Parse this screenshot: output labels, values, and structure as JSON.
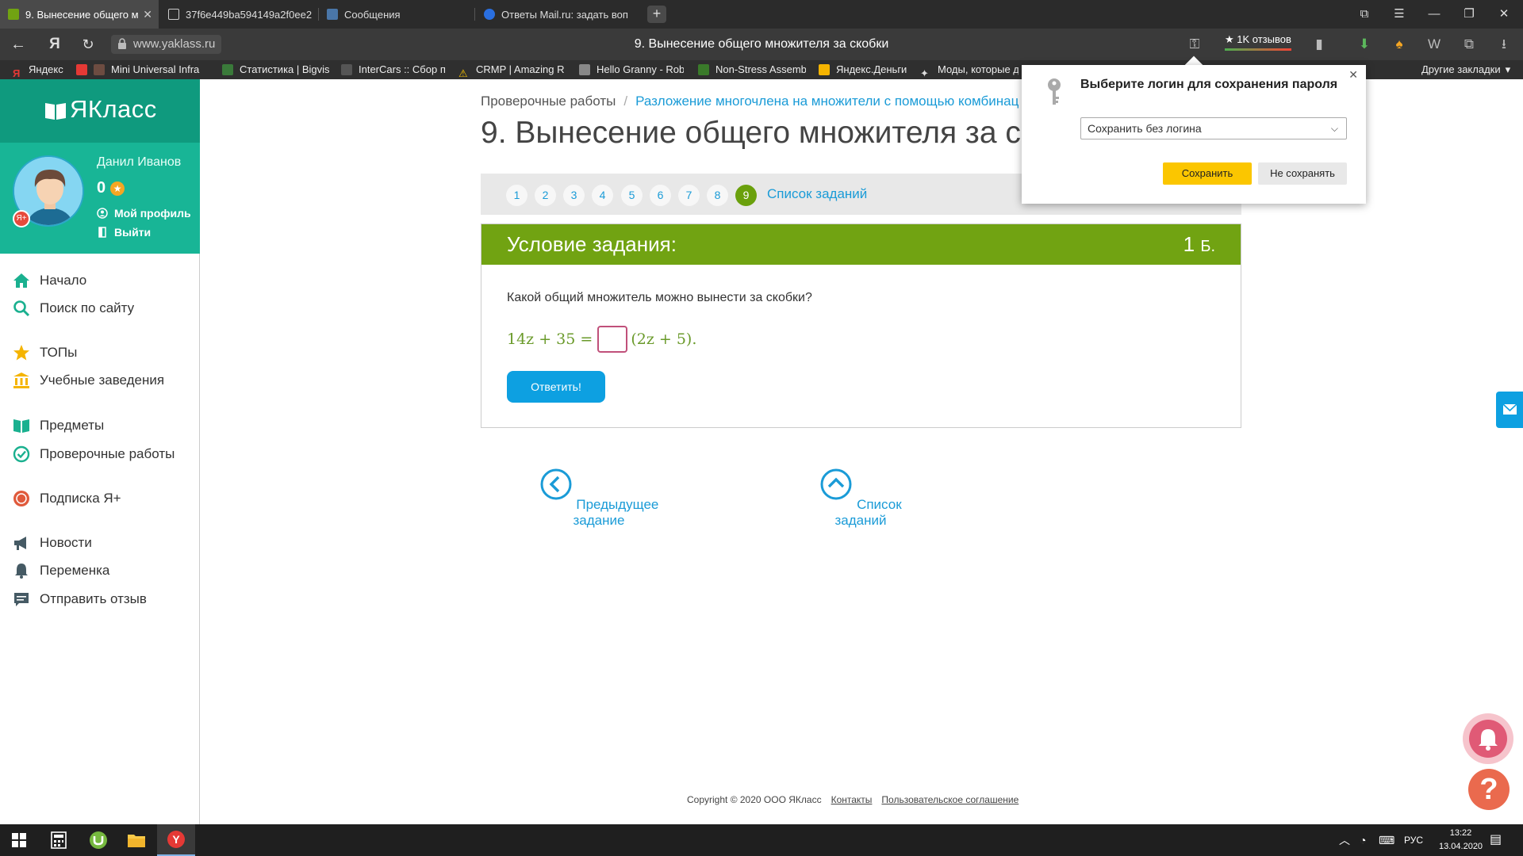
{
  "browser": {
    "tabs": [
      {
        "title": "9. Вынесение общего м",
        "color": "#71a312"
      },
      {
        "title": "37f6e449ba594149a2f0ee2",
        "color": "#ddd"
      },
      {
        "title": "Сообщения",
        "color": "#4a76a8"
      },
      {
        "title": "Ответы Mail.ru: задать воп",
        "color": "#2a6fe0"
      }
    ],
    "url": "www.yaklass.ru",
    "page_title": "9. Вынесение общего множителя за скобки",
    "reviews": "★ 1K отзывов",
    "bookmarks": [
      {
        "label": "Яндекс",
        "color": "#e53935"
      },
      {
        "label": "Mini Universal Infra",
        "color": "#6d4c41"
      },
      {
        "label": "Статистика | Bigvis",
        "color": "#3a7a3a"
      },
      {
        "label": "InterCars :: Сбор п",
        "color": "#555"
      },
      {
        "label": "CRMP | Amazing R",
        "color": "#f5c000"
      },
      {
        "label": "Hello Granny - Rob",
        "color": "#888"
      },
      {
        "label": "Non-Stress Assemb",
        "color": "#3a7a2a"
      },
      {
        "label": "Яндекс.Деньги",
        "color": "#f5b400"
      },
      {
        "label": "Моды, которые д",
        "color": "#ddd"
      }
    ],
    "other_bookmarks": "Другие закладки"
  },
  "sidebar": {
    "logo": "ЯКласс",
    "user_name": "Данил Иванов",
    "score": "0",
    "profile_link": "Мой профиль",
    "logout_link": "Выйти",
    "menu": [
      {
        "label": "Начало",
        "icon": "home-icon"
      },
      {
        "label": "Поиск по сайту",
        "icon": "search-icon"
      },
      {
        "label": "ТОПы",
        "icon": "star-icon"
      },
      {
        "label": "Учебные заведения",
        "icon": "institution-icon"
      },
      {
        "label": "Предметы",
        "icon": "book-icon"
      },
      {
        "label": "Проверочные работы",
        "icon": "check-circle-icon"
      },
      {
        "label": "Подписка Я+",
        "icon": "subscription-icon"
      },
      {
        "label": "Новости",
        "icon": "megaphone-icon"
      },
      {
        "label": "Переменка",
        "icon": "bell-icon"
      },
      {
        "label": "Отправить отзыв",
        "icon": "feedback-icon"
      }
    ]
  },
  "main": {
    "breadcrumb": [
      "Проверочные работы",
      "Разложение многочлена на множители с помощью комбинац"
    ],
    "title": "9. Вынесение общего множителя за ско",
    "pages": [
      "1",
      "2",
      "3",
      "4",
      "5",
      "6",
      "7",
      "8",
      "9"
    ],
    "current_page": "9",
    "task_list_link": "Список заданий",
    "task_header": "Условие задания:",
    "points": "1",
    "points_unit": "Б.",
    "question": "Какой общий множитель можно вынести за скобки?",
    "formula_left": "14z + 35 =",
    "formula_right": "(2z + 5).",
    "answer_button": "Ответить!",
    "prev_task": "Предыдущее задание",
    "task_list": "Список заданий"
  },
  "footer": {
    "copyright": "Copyright © 2020 ООО ЯКласс",
    "contacts": "Контакты",
    "agreement": "Пользовательское соглашение"
  },
  "popup": {
    "title": "Выберите логин для сохранения пароля",
    "select_value": "Сохранить без логина",
    "save": "Сохранить",
    "dont_save": "Не сохранять"
  },
  "taskbar": {
    "lang": "РУС",
    "time": "13:22",
    "date": "13.04.2020"
  },
  "colors": {
    "brand_green": "#18b596",
    "task_header": "#71a312",
    "link_blue": "#1a9bd7",
    "button_blue": "#0da0e1",
    "popup_save": "#fbc600"
  }
}
